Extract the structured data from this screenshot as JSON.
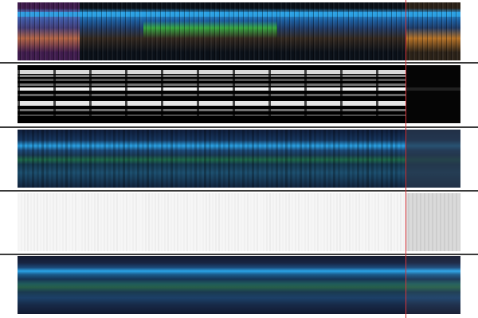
{
  "viewer": {
    "panels": [
      {
        "id": "p0",
        "kind": "photo-strip"
      },
      {
        "id": "p1",
        "kind": "binary-mask"
      },
      {
        "id": "p2",
        "kind": "color-profile"
      },
      {
        "id": "p3",
        "kind": "grayscale-profile"
      },
      {
        "id": "p4",
        "kind": "mean-color-bands"
      }
    ],
    "colors": {
      "marker": "#d8343a",
      "separator": "#3a3a3a",
      "accent_cyan": "#2aa3e6",
      "accent_green": "#3bbf4a",
      "accent_orange": "#d98a2a",
      "accent_magenta": "#b04aa8"
    }
  }
}
